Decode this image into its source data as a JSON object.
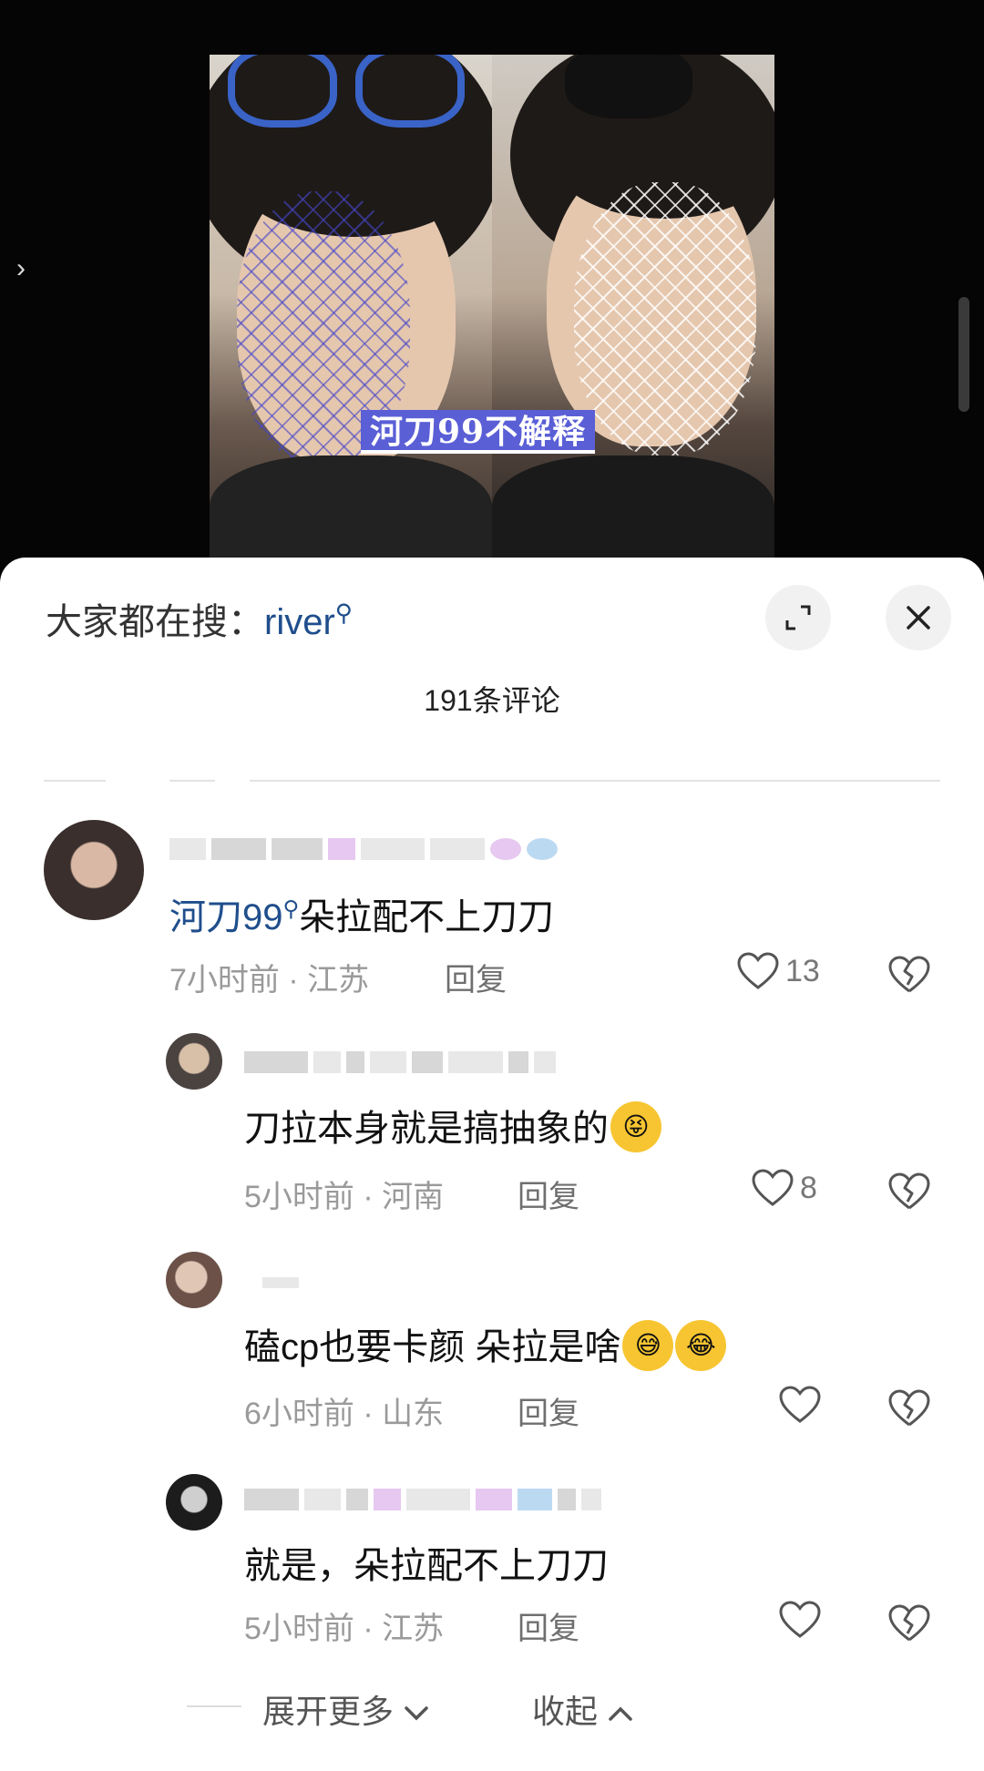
{
  "video": {
    "caption": "河刀99不解释"
  },
  "search": {
    "prefix": "大家都在搜：",
    "keyword": "river"
  },
  "comment_count": "191条评论",
  "comments": [
    {
      "mention": "河刀99",
      "text": "朵拉配不上刀刀",
      "time_location": "7小时前 · 江苏",
      "reply": "回复",
      "likes": "13"
    },
    {
      "text": "刀拉本身就是搞抽象的",
      "time_location": "5小时前 · 河南",
      "reply": "回复",
      "likes": "8"
    },
    {
      "text": "磕cp也要卡颜 朵拉是啥",
      "time_location": "6小时前 · 山东",
      "reply": "回复",
      "likes": ""
    },
    {
      "text": "就是，朵拉配不上刀刀",
      "time_location": "5小时前 · 江苏",
      "reply": "回复",
      "likes": ""
    }
  ],
  "footer": {
    "expand_more": "展开更多",
    "collapse": "收起"
  },
  "colors": {
    "mention_blue": "#1f4e8c",
    "caption_bg": "#5a5fd6",
    "meta_gray": "#9a9a9a"
  },
  "icons": [
    "chevron-right-icon",
    "search-icon",
    "expand-icon",
    "close-icon",
    "heart-icon",
    "broken-heart-icon",
    "chevron-down-icon",
    "chevron-up-icon"
  ]
}
